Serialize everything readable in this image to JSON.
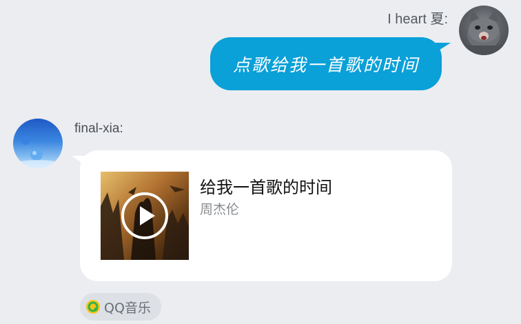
{
  "outgoing": {
    "sender": "I heart 夏:",
    "message": "点歌给我一首歌的时间",
    "avatar_icon": "cat-avatar-icon"
  },
  "incoming": {
    "sender": "final-xia:",
    "avatar_icon": "blue-balloon-avatar-icon",
    "song_card": {
      "title": "给我一首歌的时间",
      "artist": "周杰伦",
      "cover_icon": "album-cover-icon",
      "play_icon": "play-icon"
    },
    "source": {
      "label": "QQ音乐",
      "icon": "qq-music-icon"
    }
  },
  "colors": {
    "background": "#ebedf1",
    "outgoing_bubble": "#0aa0d8",
    "incoming_bubble": "#ffffff"
  }
}
